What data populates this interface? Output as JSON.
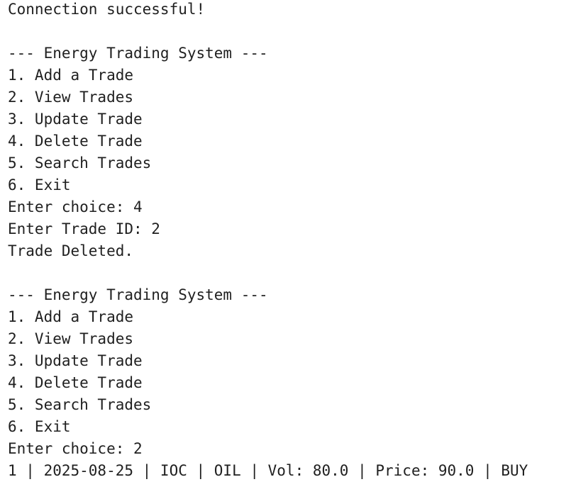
{
  "console": {
    "lines": [
      "Connection successful!",
      "",
      "--- Energy Trading System ---",
      "1. Add a Trade",
      "2. View Trades",
      "3. Update Trade",
      "4. Delete Trade",
      "5. Search Trades",
      "6. Exit",
      "Enter choice: 4",
      "Enter Trade ID: 2",
      "Trade Deleted.",
      "",
      "--- Energy Trading System ---",
      "1. Add a Trade",
      "2. View Trades",
      "3. Update Trade",
      "4. Delete Trade",
      "5. Search Trades",
      "6. Exit",
      "Enter choice: 2",
      "1 | 2025-08-25 | IOC | OIL | Vol: 80.0 | Price: 90.0 | BUY"
    ]
  },
  "colors": {
    "background": "#ffffff",
    "text": "#1f1f1f"
  }
}
